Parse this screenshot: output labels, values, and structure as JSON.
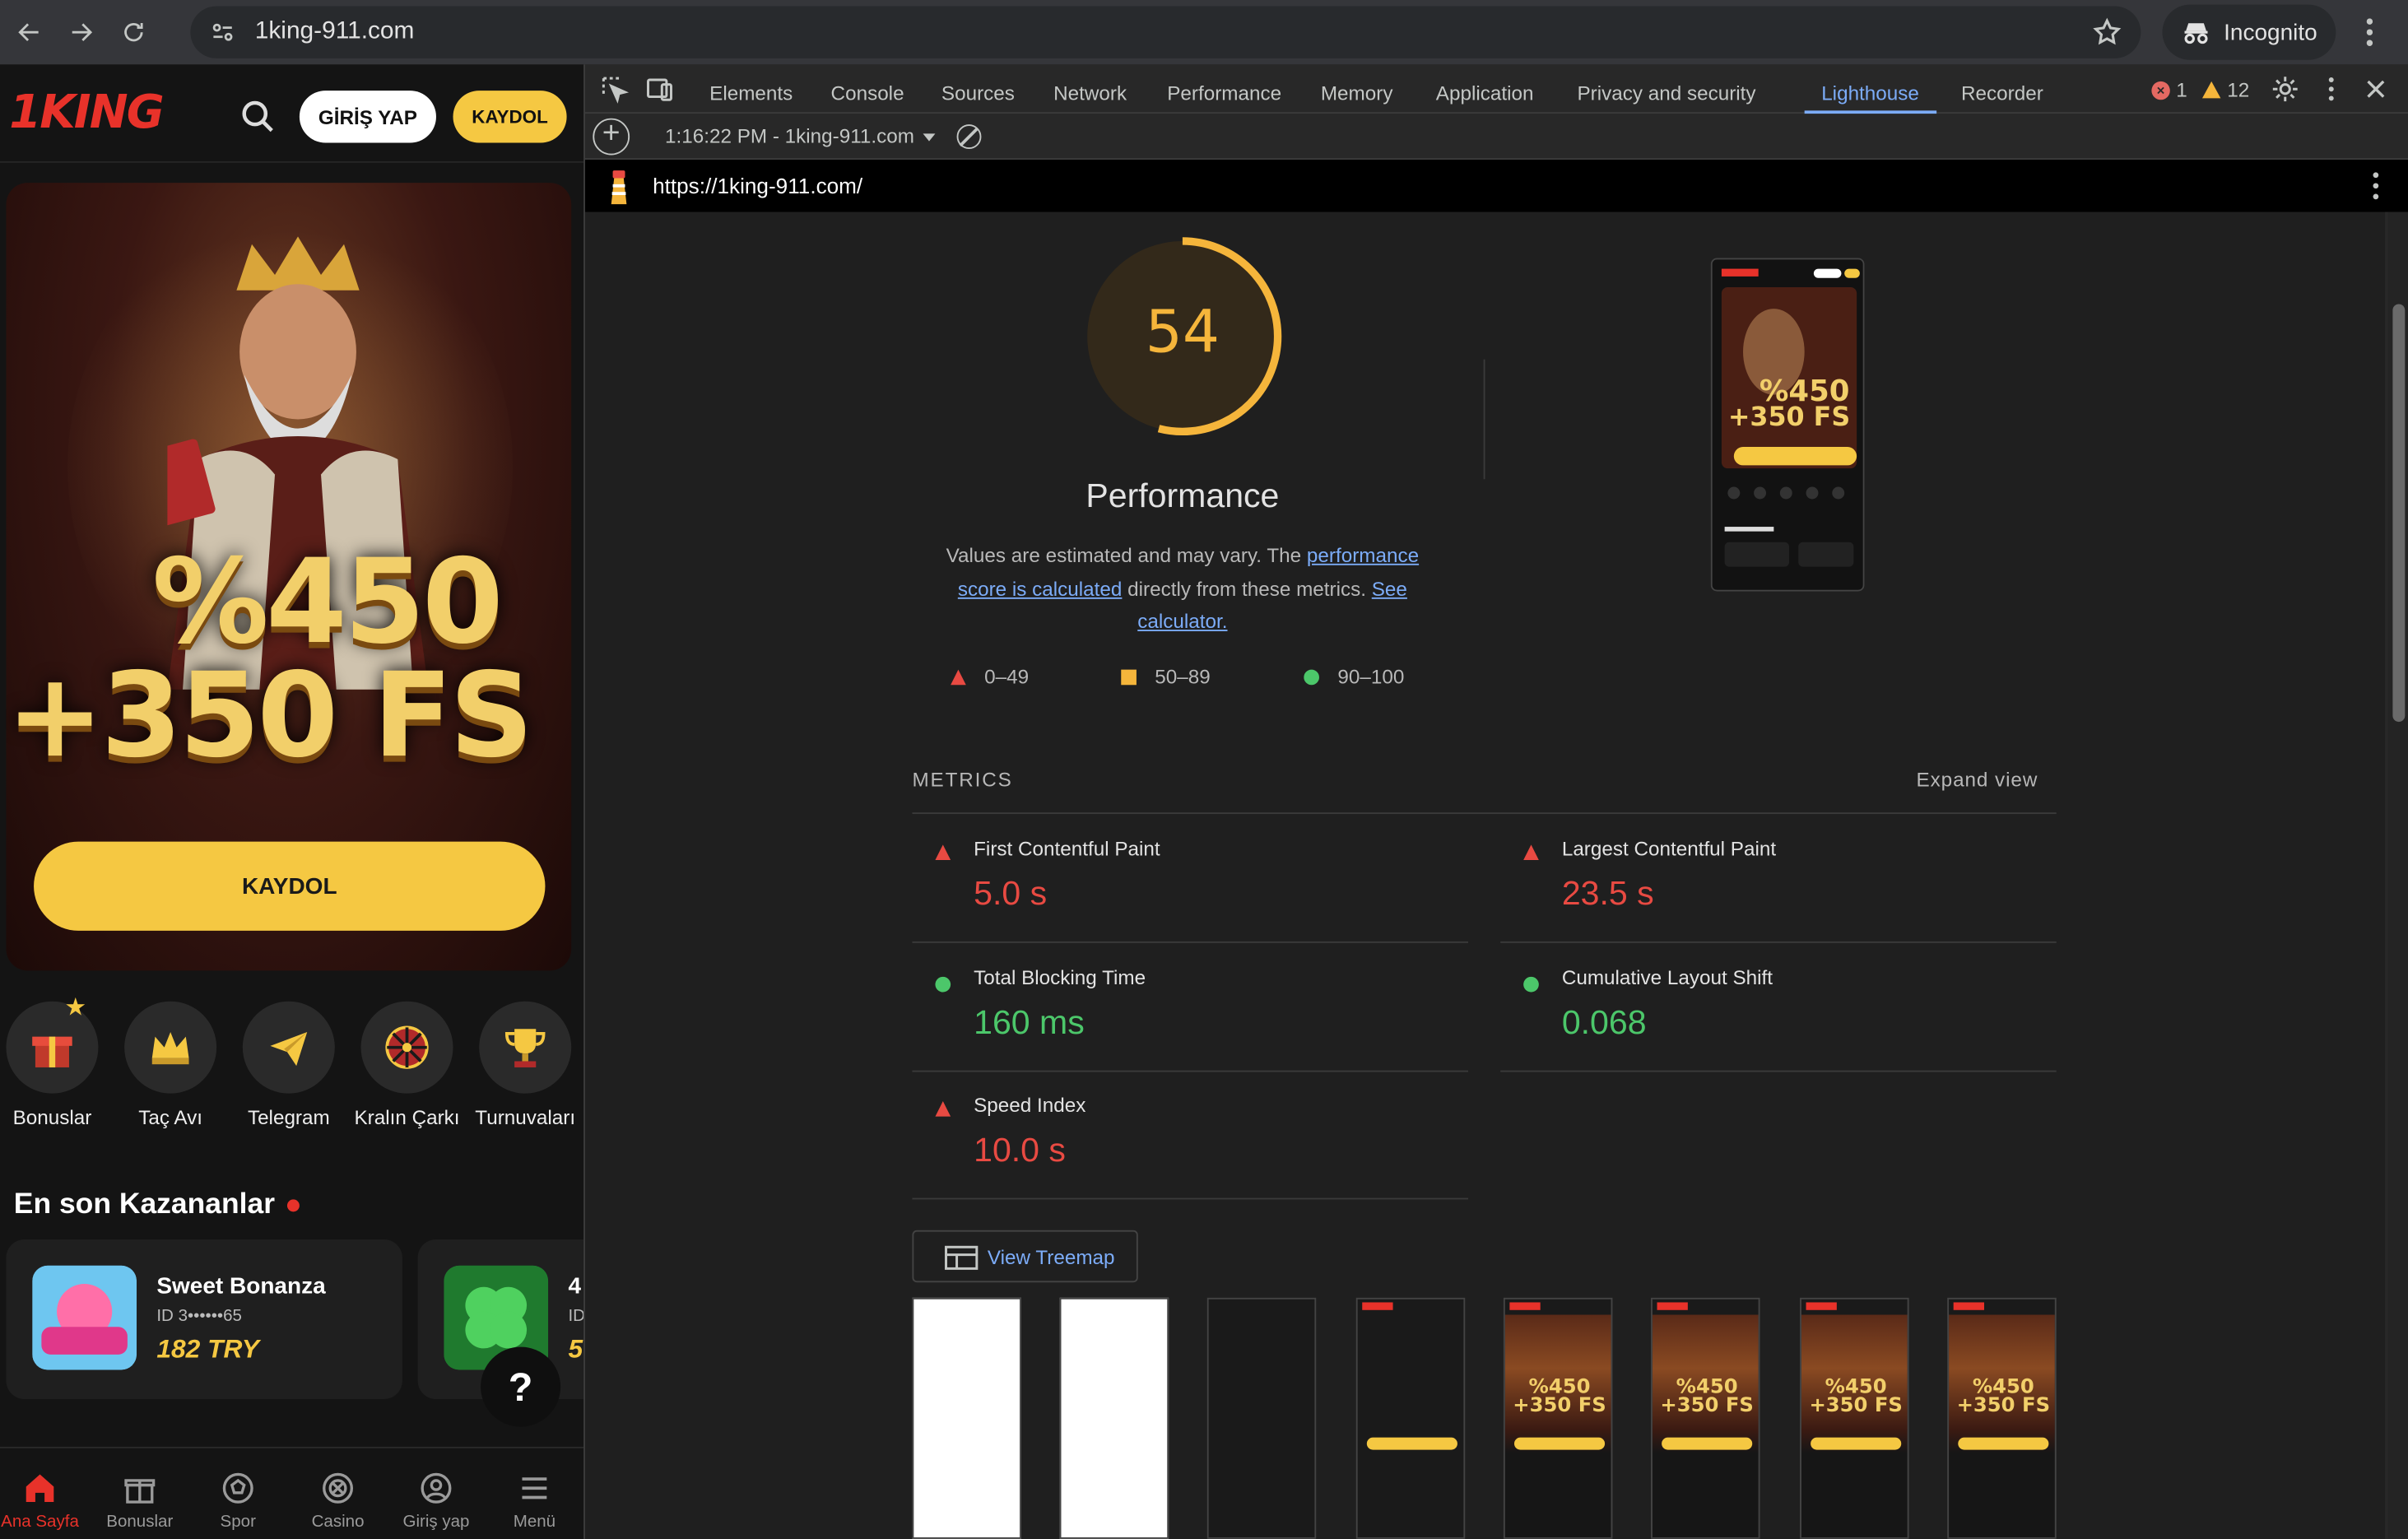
{
  "browser": {
    "url": "1king-911.com",
    "incognito_label": "Incognito"
  },
  "site": {
    "logo_text": "1KING",
    "login_label": "GİRİŞ YAP",
    "register_label": "KAYDOL",
    "hero": {
      "promo_line1": "%450",
      "promo_line2": "+350 FS",
      "cta_label": "KAYDOL"
    },
    "quick_links": [
      {
        "label": "Bonuslar",
        "icon": "gift-icon"
      },
      {
        "label": "Taç Avı",
        "icon": "crown-icon"
      },
      {
        "label": "Telegram",
        "icon": "telegram-icon"
      },
      {
        "label": "Kralın Çarkı",
        "icon": "wheel-icon"
      },
      {
        "label": "Turnuvaları",
        "icon": "trophy-icon"
      }
    ],
    "latest_winners_title": "En son Kazananlar",
    "winners": [
      {
        "game": "Sweet Bonanza",
        "id": "ID 3••••••65",
        "amount": "182 TRY"
      },
      {
        "game": "4",
        "id": "ID",
        "amount": "5"
      }
    ],
    "help_label": "?",
    "bottom_nav": [
      {
        "label": "Ana Sayfa",
        "icon": "home-icon"
      },
      {
        "label": "Bonuslar",
        "icon": "gift-icon"
      },
      {
        "label": "Spor",
        "icon": "soccer-ball-icon"
      },
      {
        "label": "Casino",
        "icon": "casino-chip-icon"
      },
      {
        "label": "Giriş yap",
        "icon": "user-icon"
      },
      {
        "label": "Menü",
        "icon": "menu-icon"
      }
    ],
    "colors": {
      "brand_red": "#e8322a",
      "brand_yellow": "#f5c842"
    }
  },
  "devtools": {
    "tabs": [
      "Elements",
      "Console",
      "Sources",
      "Network",
      "Performance",
      "Memory",
      "Application",
      "Privacy and security",
      "Lighthouse",
      "Recorder"
    ],
    "active_tab": "Lighthouse",
    "error_count": "1",
    "warning_count": "12",
    "report_label": "1:16:22 PM - 1king-911.com",
    "report_url": "https://1king-911.com/",
    "score": "54",
    "score_fraction": 0.54,
    "category": "Performance",
    "desc_part1": "Values are estimated and may vary. The ",
    "desc_link1": "performance score is calculated",
    "desc_part2": " directly from these metrics. ",
    "desc_link2": "See calculator.",
    "legend": {
      "fail": "0–49",
      "average": "50–89",
      "pass": "90–100"
    },
    "metrics_title": "METRICS",
    "expand_label": "Expand view",
    "metrics": [
      {
        "name": "First Contentful Paint",
        "value": "5.0 s",
        "status": "fail"
      },
      {
        "name": "Largest Contentful Paint",
        "value": "23.5 s",
        "status": "fail"
      },
      {
        "name": "Total Blocking Time",
        "value": "160 ms",
        "status": "pass"
      },
      {
        "name": "Cumulative Layout Shift",
        "value": "0.068",
        "status": "pass"
      },
      {
        "name": "Speed Index",
        "value": "10.0 s",
        "status": "fail"
      }
    ],
    "treemap_label": "View Treemap",
    "filmstrip_promo": "%450 +350 FS",
    "colors": {
      "score_orange": "#f5b53b",
      "fail_red": "#e84a42",
      "pass_green": "#4cc76a",
      "link_blue": "#7cacf8"
    }
  }
}
